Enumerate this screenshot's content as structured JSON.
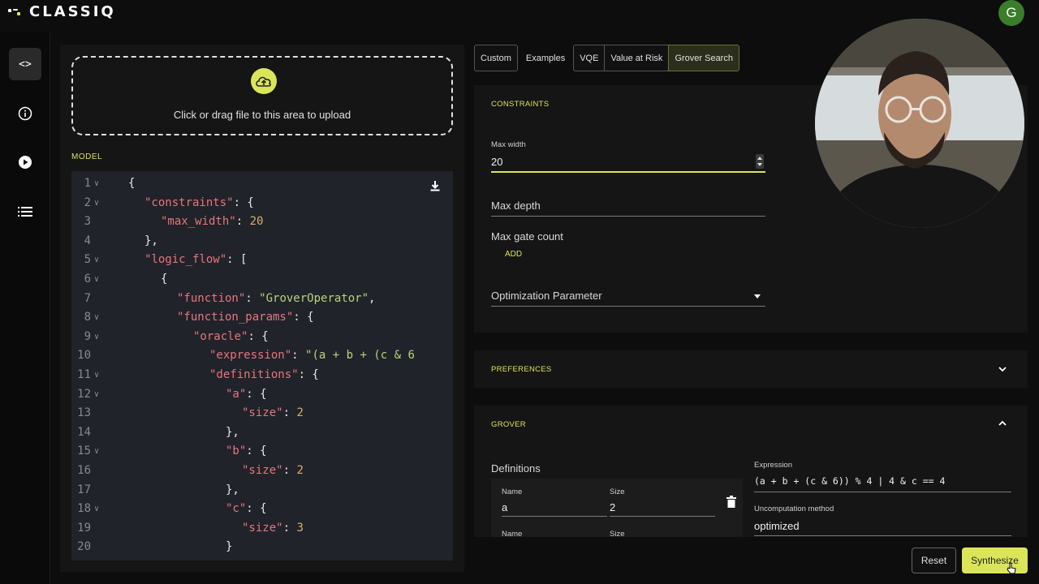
{
  "app": {
    "logo_text": "CLASSIQ",
    "user_initial": "G"
  },
  "sidebar": {
    "items": [
      {
        "name": "code",
        "icon": "code-icon"
      },
      {
        "name": "info",
        "icon": "info-icon"
      },
      {
        "name": "run",
        "icon": "play-icon"
      },
      {
        "name": "list",
        "icon": "list-icon"
      }
    ]
  },
  "upload": {
    "text": "Click or drag file to this area to upload"
  },
  "model": {
    "label": "MODEL",
    "lines": [
      {
        "n": "1",
        "fold": true,
        "indent": 0,
        "html": [
          [
            "p",
            "{"
          ]
        ]
      },
      {
        "n": "2",
        "fold": true,
        "indent": 1,
        "html": [
          [
            "k",
            "\"constraints\""
          ],
          [
            "p",
            ": {"
          ]
        ]
      },
      {
        "n": "3",
        "fold": false,
        "indent": 2,
        "html": [
          [
            "k",
            "\"max_width\""
          ],
          [
            "p",
            ": "
          ],
          [
            "n",
            "20"
          ]
        ]
      },
      {
        "n": "4",
        "fold": false,
        "indent": 1,
        "html": [
          [
            "p",
            "},"
          ]
        ]
      },
      {
        "n": "5",
        "fold": true,
        "indent": 1,
        "html": [
          [
            "k",
            "\"logic_flow\""
          ],
          [
            "p",
            ": ["
          ]
        ]
      },
      {
        "n": "6",
        "fold": true,
        "indent": 2,
        "html": [
          [
            "p",
            "{"
          ]
        ]
      },
      {
        "n": "7",
        "fold": false,
        "indent": 3,
        "html": [
          [
            "k",
            "\"function\""
          ],
          [
            "p",
            ": "
          ],
          [
            "s",
            "\"GroverOperator\""
          ],
          [
            "p",
            ","
          ]
        ]
      },
      {
        "n": "8",
        "fold": true,
        "indent": 3,
        "html": [
          [
            "k",
            "\"function_params\""
          ],
          [
            "p",
            ": {"
          ]
        ]
      },
      {
        "n": "9",
        "fold": true,
        "indent": 4,
        "html": [
          [
            "k",
            "\"oracle\""
          ],
          [
            "p",
            ": {"
          ]
        ]
      },
      {
        "n": "10",
        "fold": false,
        "indent": 5,
        "html": [
          [
            "k",
            "\"expression\""
          ],
          [
            "p",
            ": "
          ],
          [
            "s",
            "\"(a + b + (c & 6"
          ]
        ]
      },
      {
        "n": "11",
        "fold": true,
        "indent": 5,
        "html": [
          [
            "k",
            "\"definitions\""
          ],
          [
            "p",
            ": {"
          ]
        ]
      },
      {
        "n": "12",
        "fold": true,
        "indent": 6,
        "html": [
          [
            "k",
            "\"a\""
          ],
          [
            "p",
            ": {"
          ]
        ]
      },
      {
        "n": "13",
        "fold": false,
        "indent": 7,
        "html": [
          [
            "k",
            "\"size\""
          ],
          [
            "p",
            ": "
          ],
          [
            "n",
            "2"
          ]
        ]
      },
      {
        "n": "14",
        "fold": false,
        "indent": 6,
        "html": [
          [
            "p",
            "},"
          ]
        ]
      },
      {
        "n": "15",
        "fold": true,
        "indent": 6,
        "html": [
          [
            "k",
            "\"b\""
          ],
          [
            "p",
            ": {"
          ]
        ]
      },
      {
        "n": "16",
        "fold": false,
        "indent": 7,
        "html": [
          [
            "k",
            "\"size\""
          ],
          [
            "p",
            ": "
          ],
          [
            "n",
            "2"
          ]
        ]
      },
      {
        "n": "17",
        "fold": false,
        "indent": 6,
        "html": [
          [
            "p",
            "},"
          ]
        ]
      },
      {
        "n": "18",
        "fold": true,
        "indent": 6,
        "html": [
          [
            "k",
            "\"c\""
          ],
          [
            "p",
            ": {"
          ]
        ]
      },
      {
        "n": "19",
        "fold": false,
        "indent": 7,
        "html": [
          [
            "k",
            "\"size\""
          ],
          [
            "p",
            ": "
          ],
          [
            "n",
            "3"
          ]
        ]
      },
      {
        "n": "20",
        "fold": false,
        "indent": 6,
        "html": [
          [
            "p",
            "}"
          ]
        ]
      }
    ]
  },
  "tabs": {
    "custom": "Custom",
    "examples": "Examples",
    "vqe": "VQE",
    "var": "Value at Risk",
    "grover": "Grover Search"
  },
  "constraints": {
    "title": "CONSTRAINTS",
    "max_width_label": "Max width",
    "max_width_value": "20",
    "max_depth_label": "Max depth",
    "max_gate_count_label": "Max gate count",
    "add_label": "ADD",
    "opt_param_label": "Optimization Parameter"
  },
  "preferences": {
    "title": "PREFERENCES"
  },
  "grover": {
    "title": "GROVER",
    "definitions_label": "Definitions",
    "name_label": "Name",
    "size_label": "Size",
    "row1_name": "a",
    "row1_size": "2",
    "name_label2": "Name",
    "size_label2": "Size",
    "expression_label": "Expression",
    "expression_value": "(a + b + (c & 6)) % 4 | 4 & c == 4",
    "uncomp_label": "Uncomputation method",
    "uncomp_value": "optimized"
  },
  "actions": {
    "reset": "Reset",
    "synthesize": "Synthesize"
  },
  "colors": {
    "accent": "#dbe55a",
    "background": "#0d0d0d",
    "panel": "#151515",
    "code_bg": "#20232a"
  }
}
